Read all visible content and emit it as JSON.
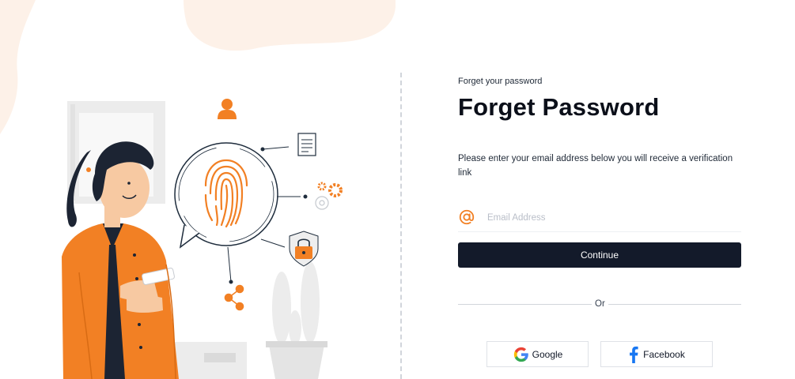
{
  "colors": {
    "accent": "#f28024",
    "primary_button": "#131a2a",
    "blob": "#fdf1e8"
  },
  "page": {
    "eyebrow": "Forget your password",
    "title": "Forget Password",
    "description": "Please enter your email address below you will receive a verification link"
  },
  "form": {
    "email_icon": "at-sign-icon",
    "email_value": "",
    "email_placeholder": "Email Address",
    "continue_label": "Continue"
  },
  "separator": {
    "label": "Or"
  },
  "social": {
    "google_icon": "google-icon",
    "google_label": "Google",
    "facebook_icon": "facebook-icon",
    "facebook_label": "Facebook"
  },
  "illustration": {
    "icons": [
      "user-icon",
      "fingerprint-icon",
      "document-icon",
      "gears-icon",
      "padlock-icon",
      "share-icon"
    ]
  }
}
